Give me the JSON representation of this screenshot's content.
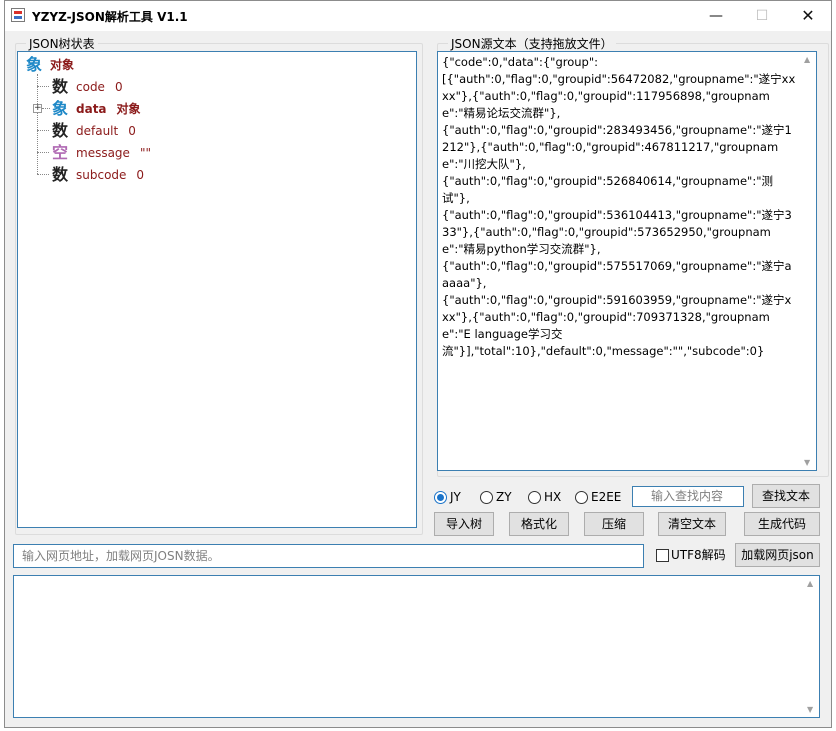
{
  "window": {
    "title": "YZYZ-JSON解析工具 V1.1",
    "controls": {
      "minimize": "—",
      "maximize": "☐",
      "close": "✕"
    }
  },
  "tree_panel": {
    "legend": "JSON树状表",
    "root": {
      "icon": "象",
      "key": "对象"
    },
    "nodes": [
      {
        "icon": "数",
        "key": "code",
        "value": "0"
      },
      {
        "icon": "象",
        "key": "data",
        "value": "对象"
      },
      {
        "icon": "数",
        "key": "default",
        "value": "0"
      },
      {
        "icon": "空",
        "key": "message",
        "value": "\"\""
      },
      {
        "icon": "数",
        "key": "subcode",
        "value": "0"
      }
    ]
  },
  "json_panel": {
    "legend": "JSON源文本（支持拖放文件）",
    "text": "{\"code\":0,\"data\":{\"group\":\n[{\"auth\":0,\"flag\":0,\"groupid\":56472082,\"groupname\":\"遂宁xxxx\"},{\"auth\":0,\"flag\":0,\"groupid\":117956898,\"groupname\":\"精易论坛交流群\"},\n{\"auth\":0,\"flag\":0,\"groupid\":283493456,\"groupname\":\"遂宁1212\"},{\"auth\":0,\"flag\":0,\"groupid\":467811217,\"groupname\":\"川挖大队\"},\n{\"auth\":0,\"flag\":0,\"groupid\":526840614,\"groupname\":\"测试\"},\n{\"auth\":0,\"flag\":0,\"groupid\":536104413,\"groupname\":\"遂宁333\"},{\"auth\":0,\"flag\":0,\"groupid\":573652950,\"groupname\":\"精易python学习交流群\"},\n{\"auth\":0,\"flag\":0,\"groupid\":575517069,\"groupname\":\"遂宁aaaaa\"},\n{\"auth\":0,\"flag\":0,\"groupid\":591603959,\"groupname\":\"遂宁xxx\"},{\"auth\":0,\"flag\":0,\"groupid\":709371328,\"groupname\":\"E language学习交\n流\"}],\"total\":10},\"default\":0,\"message\":\"\",\"subcode\":0}"
  },
  "encoding_options": {
    "selected": "JY",
    "items": [
      "JY",
      "ZY",
      "HX",
      "E2EE"
    ]
  },
  "search": {
    "placeholder": "输入查找内容",
    "button": "查找文本"
  },
  "actions": {
    "import_tree": "导入树",
    "format": "格式化",
    "compress": "压缩",
    "clear_text": "清空文本",
    "generate_code": "生成代码"
  },
  "url_bar": {
    "placeholder": "输入网页地址，加载网页JOSN数据。",
    "utf8_label": "UTF8解码",
    "utf8_checked": false,
    "load_button": "加载网页json"
  },
  "colors": {
    "border_accent": "#3c7fb1",
    "tree_text": "#8b1a1a",
    "object_icon": "#1e88c7",
    "null_icon": "#b06ab3",
    "radio_selected": "#1a73c9"
  }
}
